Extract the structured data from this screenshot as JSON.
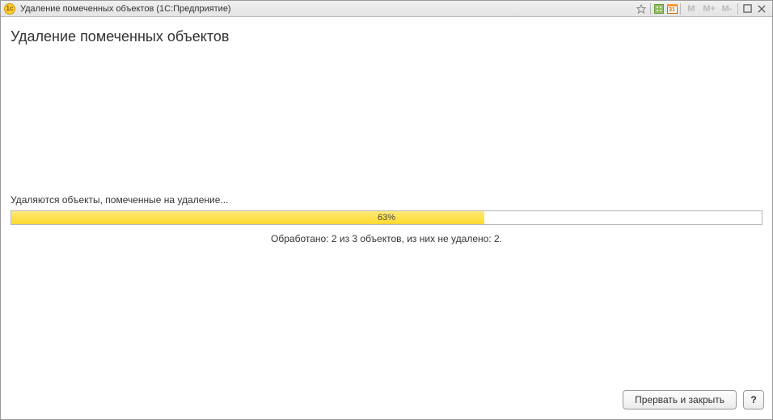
{
  "titlebar": {
    "app_icon_text": "1c",
    "title": "Удаление помеченных объектов  (1С:Предприятие)",
    "calendar_day": "31",
    "m_labels": [
      "M",
      "M+",
      "M-"
    ]
  },
  "page": {
    "title": "Удаление помеченных объектов"
  },
  "progress": {
    "status": "Удаляются объекты, помеченные на удаление...",
    "percent_value": 63,
    "percent_label": "63%",
    "fill_width": "63%",
    "summary": "Обработано: 2 из 3 объектов, из них не удалено: 2."
  },
  "footer": {
    "abort_label": "Прервать и закрыть",
    "help_label": "?"
  }
}
